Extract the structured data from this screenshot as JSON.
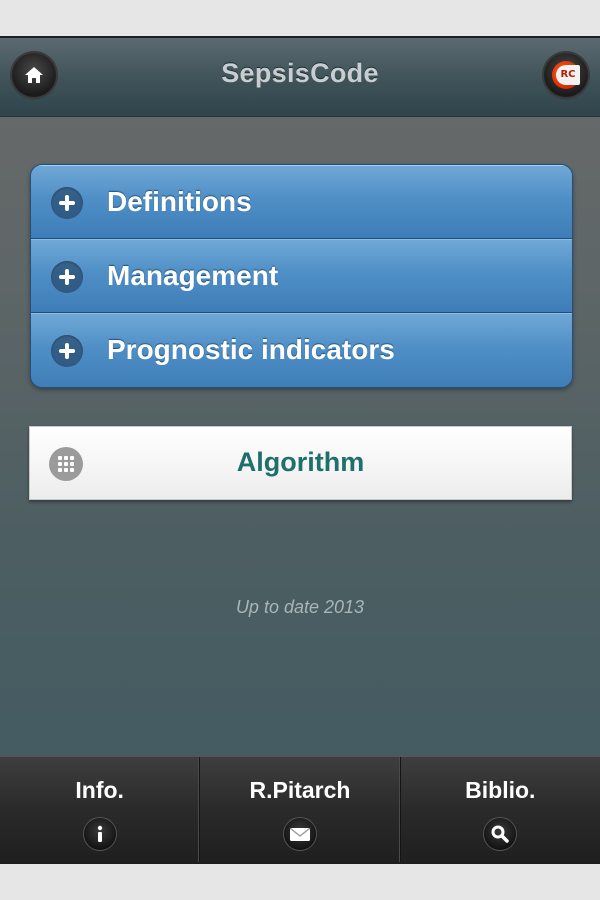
{
  "header": {
    "title": "SepsisCode",
    "home_icon": "home-icon",
    "logo_icon": "rc-logo-icon",
    "logo_text": "RC"
  },
  "accordion": {
    "items": [
      {
        "label": "Definitions",
        "icon": "plus-icon"
      },
      {
        "label": "Management",
        "icon": "plus-icon"
      },
      {
        "label": "Prognostic indicators",
        "icon": "plus-icon"
      }
    ]
  },
  "algorithm": {
    "label": "Algorithm",
    "icon": "grid-icon"
  },
  "update_note": "Up to date 2013",
  "footer": {
    "tabs": [
      {
        "label": "Info.",
        "icon": "info-icon"
      },
      {
        "label": "R.Pitarch",
        "icon": "mail-icon"
      },
      {
        "label": "Biblio.",
        "icon": "search-icon"
      }
    ]
  },
  "colors": {
    "accordion_blue": "#4f8fc6",
    "algorithm_text": "#1f6f6c",
    "header_title": "#c7cdd0"
  }
}
